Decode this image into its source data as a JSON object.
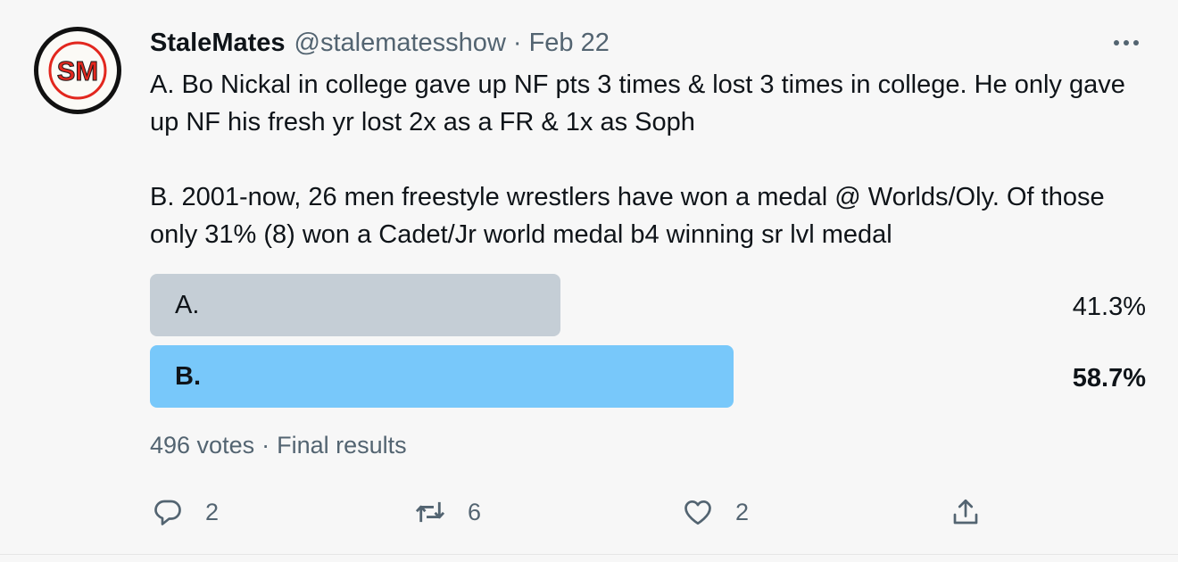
{
  "tweet": {
    "author": {
      "display_name": "StaleMates",
      "handle": "@stalematesshow",
      "avatar_icon": "sm-logo-avatar"
    },
    "separator": "·",
    "date": "Feb 22",
    "more_icon": "more-dots-icon",
    "text": {
      "paragraph_a": "A. Bo Nickal in college gave up NF pts 3 times & lost 3 times in college. He only gave up NF his fresh yr lost 2x as a FR & 1x as Soph",
      "paragraph_b": "B. 2001-now, 26 men freestyle wrestlers have won a medal @ Worlds/Oly. Of those only 31% (8) won a Cadet/Jr world medal b4 winning sr lvl medal"
    },
    "poll": {
      "options": [
        {
          "label": "A.",
          "percent_text": "41.3%",
          "percent": 41.3,
          "color": "#c5ced6",
          "winner": false
        },
        {
          "label": "B.",
          "percent_text": "58.7%",
          "percent": 58.7,
          "color": "#78c8fa",
          "winner": true
        }
      ],
      "votes": "496 votes",
      "separator": "·",
      "status": "Final results"
    },
    "actions": {
      "reply": {
        "icon": "reply-icon",
        "count": "2"
      },
      "retweet": {
        "icon": "retweet-icon",
        "count": "6"
      },
      "like": {
        "icon": "heart-icon",
        "count": "2"
      },
      "share": {
        "icon": "share-icon"
      }
    }
  }
}
